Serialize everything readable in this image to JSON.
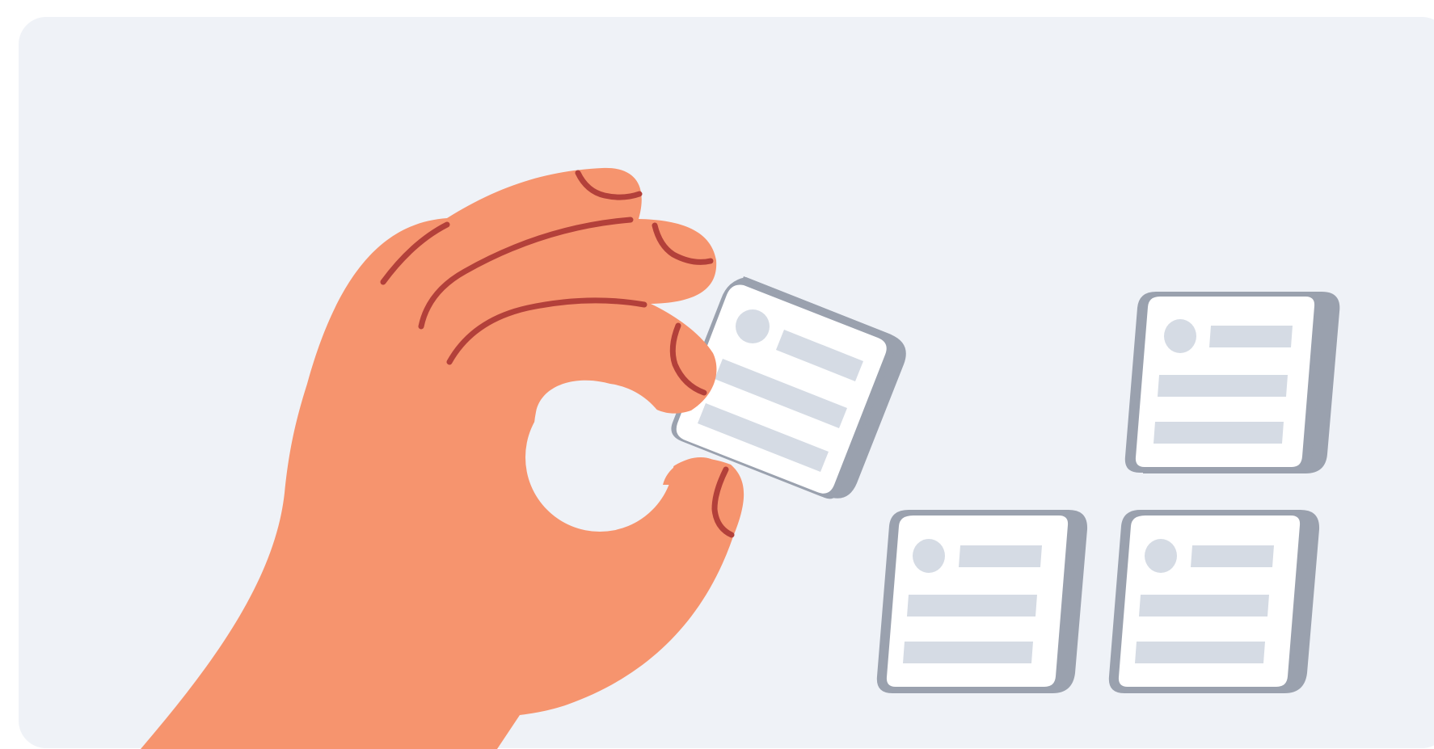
{
  "illustration": {
    "subject": "hand-picking-card-icon",
    "colors": {
      "page": "#ffffff",
      "panel": "#eff2f7",
      "skin": "#f6946e",
      "crease": "#b3403a",
      "card_face": "#ffffff",
      "card_shadow": "#9aa1ae",
      "card_outline": "#9aa1ae",
      "placeholder": "#d5dbe4"
    }
  }
}
